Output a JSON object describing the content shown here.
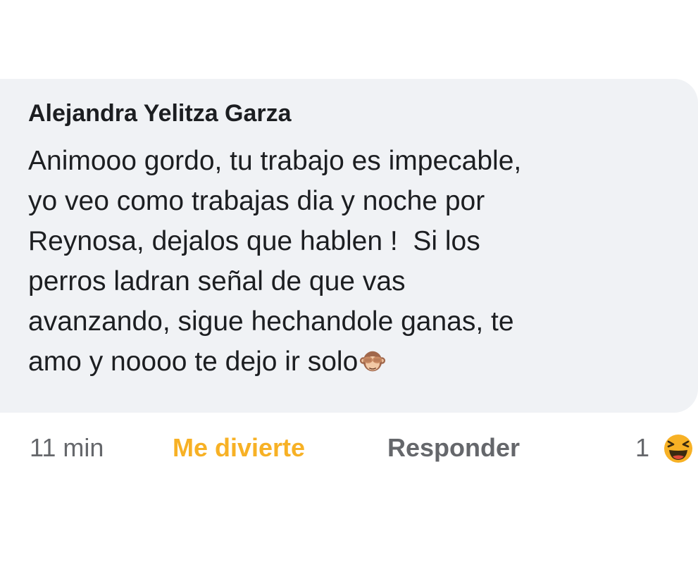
{
  "comment": {
    "author": "Alejandra Yelitza Garza",
    "lines": [
      "Animooo gordo, tu trabajo es impecable,",
      "yo veo como trabajas dia y noche por",
      "Reynosa, dejalos que hablen !  Si los",
      "perros ladran señal de que vas",
      "avanzando, sigue hechandole ganas, te",
      "amo y noooo te dejo ir solo"
    ],
    "trailing_emoji": "see-no-evil-monkey-icon"
  },
  "actions": {
    "timestamp": "11 min",
    "reaction_label": "Me divierte",
    "reply_label": "Responder",
    "reaction_count": "1",
    "reaction_icon": "haha-reaction-icon"
  },
  "colors": {
    "bubble_background": "#f0f2f5",
    "text": "#1c1e21",
    "muted": "#65676b",
    "haha_yellow": "#f7b125"
  }
}
